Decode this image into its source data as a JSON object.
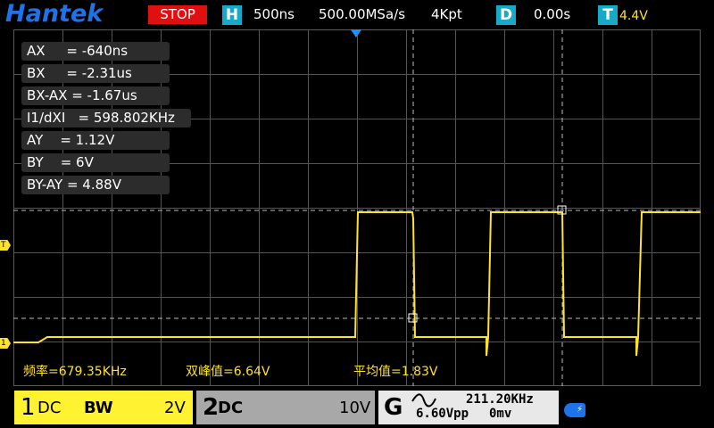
{
  "header": {
    "logo": "Hantek",
    "run_state": "STOP",
    "h_badge": "H",
    "timebase": "500ns",
    "sample_rate": "500.00MSa/s",
    "memory_depth": "4Kpt",
    "d_badge": "D",
    "delay": "0.00s",
    "t_badge": "T",
    "trigger_level": "4.4V"
  },
  "cursors": {
    "ax": "AX     = -640ns",
    "bx": "BX     = -2.31us",
    "bx_ax": "BX-AX = -1.67us",
    "inv_dx": "I1/dXI   = 598.802KHz",
    "ay": "AY    = 1.12V",
    "by": "BY    = 6V",
    "by_ay": "BY-AY = 4.88V"
  },
  "stats": {
    "frequency": "频率=679.35KHz",
    "peak_to_peak": "双峰值=6.64V",
    "average": "平均值=1.83V"
  },
  "markers": {
    "trigger": "T",
    "ch1": "1"
  },
  "channels": {
    "ch1": {
      "name": "1",
      "coupling": "DC",
      "bw": "BW",
      "scale": "2V"
    },
    "ch2": {
      "name": "2",
      "coupling": "DC",
      "scale": "10V"
    }
  },
  "generator": {
    "label": "G",
    "wave": "sine-wave-icon",
    "frequency": "211.20KHz",
    "amplitude": "6.60Vpp",
    "offset": "0mv"
  },
  "usb": {
    "label": "usb-icon"
  },
  "colors": {
    "ch1": "#ffe22a",
    "logo": "#1e73e8",
    "stop": "#e01010",
    "badge": "#17a9c8"
  }
}
